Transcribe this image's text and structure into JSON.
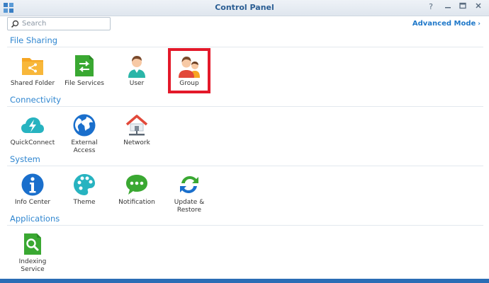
{
  "window": {
    "title": "Control Panel"
  },
  "search": {
    "placeholder": "Search"
  },
  "advanced_mode": {
    "label": "Advanced Mode"
  },
  "sections": {
    "file_sharing": {
      "title": "File Sharing",
      "items": [
        {
          "label": "Shared Folder",
          "icon": "shared-folder-icon"
        },
        {
          "label": "File Services",
          "icon": "file-services-icon"
        },
        {
          "label": "User",
          "icon": "user-icon"
        },
        {
          "label": "Group",
          "icon": "group-icon"
        }
      ]
    },
    "connectivity": {
      "title": "Connectivity",
      "items": [
        {
          "label": "QuickConnect",
          "icon": "quickconnect-icon"
        },
        {
          "label": "External Access",
          "icon": "globe-icon"
        },
        {
          "label": "Network",
          "icon": "network-house-icon"
        }
      ]
    },
    "system": {
      "title": "System",
      "items": [
        {
          "label": "Info Center",
          "icon": "info-icon"
        },
        {
          "label": "Theme",
          "icon": "palette-icon"
        },
        {
          "label": "Notification",
          "icon": "chat-bubble-icon"
        },
        {
          "label": "Update & Restore",
          "icon": "refresh-arrows-icon"
        }
      ]
    },
    "applications": {
      "title": "Applications",
      "items": [
        {
          "label": "Indexing Service",
          "icon": "search-document-icon"
        }
      ]
    }
  },
  "colors": {
    "accent": "#2f86d0",
    "highlight_border": "#e3192a"
  }
}
